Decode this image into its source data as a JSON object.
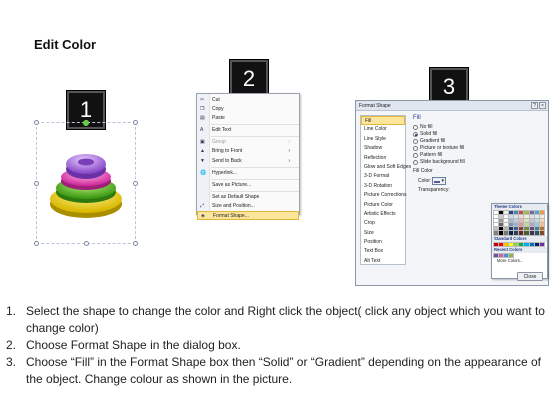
{
  "title": "Edit Color",
  "steps": [
    "1",
    "2",
    "3"
  ],
  "context_menu": {
    "items": [
      {
        "label": "Cut",
        "icon": "cut-icon",
        "enabled": true
      },
      {
        "label": "Copy",
        "icon": "copy-icon",
        "enabled": true
      },
      {
        "label": "Paste",
        "icon": "paste-icon",
        "enabled": true
      },
      {
        "label": "Edit Text",
        "icon": "edit-text-icon",
        "enabled": true
      },
      {
        "label": "Group",
        "icon": "group-icon",
        "enabled": false,
        "submenu": true
      },
      {
        "label": "Bring to Front",
        "icon": "bring-front-icon",
        "enabled": true,
        "submenu": true
      },
      {
        "label": "Send to Back",
        "icon": "send-back-icon",
        "enabled": true,
        "submenu": true
      },
      {
        "label": "Hyperlink...",
        "icon": "hyperlink-icon",
        "enabled": true
      },
      {
        "label": "Save as Picture...",
        "icon": "",
        "enabled": true
      },
      {
        "label": "Set as Default Shape",
        "icon": "",
        "enabled": true
      },
      {
        "label": "Size and Position...",
        "icon": "size-icon",
        "enabled": true
      },
      {
        "label": "Format Shape...",
        "icon": "format-shape-icon",
        "enabled": true,
        "highlighted": true
      }
    ]
  },
  "dialog": {
    "title": "Format Shape",
    "nav": [
      "Fill",
      "Line Color",
      "Line Style",
      "Shadow",
      "Reflection",
      "Glow and Soft Edges",
      "3-D Format",
      "3-D Rotation",
      "Picture Corrections",
      "Picture Color",
      "Artistic Effects",
      "Crop",
      "Size",
      "Position",
      "Text Box",
      "Alt Text"
    ],
    "selected_nav": "Fill",
    "pane_heading": "Fill",
    "fill_options": [
      "No fill",
      "Solid fill",
      "Gradient fill",
      "Picture or texture fill",
      "Pattern fill",
      "Slide background fill"
    ],
    "selected_option": "Solid fill",
    "fill_color_label": "Fill Color",
    "color_label": "Color:",
    "transparency_label": "Transparency:",
    "palette": {
      "theme_label": "Theme Colors",
      "standard_label": "Standard Colors",
      "recent_label": "Recent Colors",
      "more_label": "More Colors...",
      "theme_top": [
        "#ffffff",
        "#000000",
        "#eeece1",
        "#1f497d",
        "#4f81bd",
        "#c0504d",
        "#9bbb59",
        "#8064a2",
        "#4bacc6",
        "#f79646"
      ],
      "standard": [
        "#c00000",
        "#ff0000",
        "#ffc000",
        "#ffff00",
        "#92d050",
        "#00b050",
        "#00b0f0",
        "#0070c0",
        "#002060",
        "#7030a0"
      ],
      "recent": [
        "#6b4fa0",
        "#cc66aa",
        "#4a90d9",
        "#88bb44"
      ]
    },
    "close_label": "Close"
  },
  "instructions": [
    {
      "num": "1.",
      "text": "Select the shape to change the color and Right click the object( click any object which you want to change color)"
    },
    {
      "num": "2.",
      "text": "Choose Format Shape in the dialog box."
    },
    {
      "num": "3.",
      "text": "Choose “Fill” in the Format Shape box then “Solid” or “Gradient” depending on the appearance of the object. Change colour as shown in the picture."
    }
  ]
}
